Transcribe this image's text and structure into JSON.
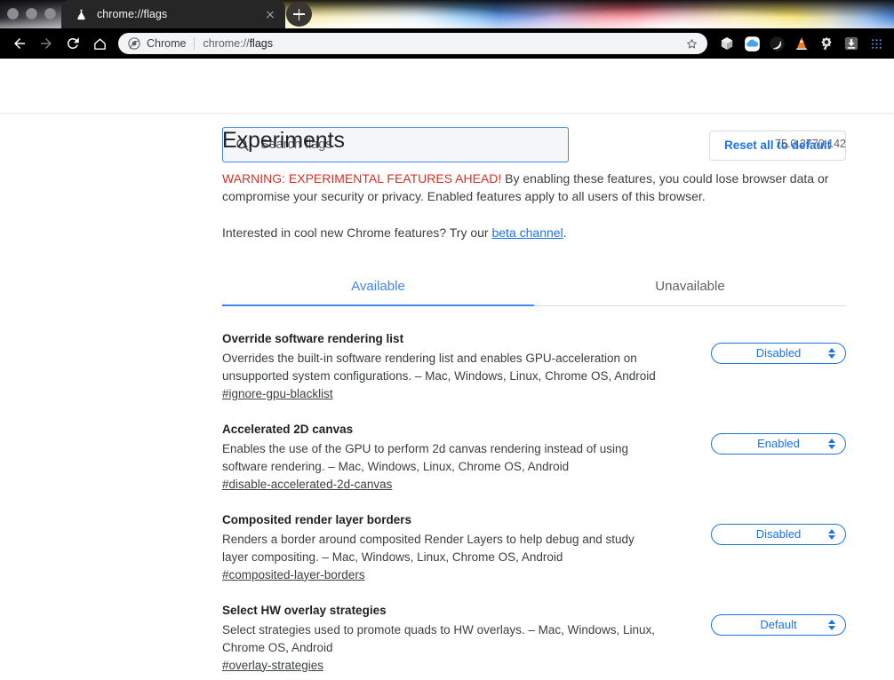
{
  "window": {
    "traffic_lights": [
      "close",
      "minimize",
      "maximize"
    ]
  },
  "tabstrip": {
    "tab": {
      "favicon": "flask-icon",
      "title": "chrome://flags",
      "close_label": "close-tab"
    },
    "new_tab_label": "New Tab"
  },
  "toolbar": {
    "back_label": "Back",
    "forward_label": "Forward",
    "reload_label": "Reload",
    "home_label": "Home",
    "omnibox": {
      "chip_icon": "chrome-logo-icon",
      "chip_text": "Chrome",
      "url_scheme": "chrome://",
      "url_path": "flags",
      "star_label": "Bookmark this page"
    },
    "extensions": [
      {
        "name": "cube-extension-icon",
        "label": "Extension"
      },
      {
        "name": "cloud-extension-icon",
        "label": "Cloud"
      },
      {
        "name": "bittorrent-extension-icon",
        "label": "BitTorrent"
      },
      {
        "name": "vlc-extension-icon",
        "label": "VLC"
      },
      {
        "name": "bug-extension-icon",
        "label": "Debug"
      },
      {
        "name": "download-extension-icon",
        "label": "Downloads"
      },
      {
        "name": "apps-grid-icon",
        "label": "Apps"
      }
    ]
  },
  "flags_page": {
    "search": {
      "icon": "search-icon",
      "placeholder": "Search flags",
      "value": ""
    },
    "reset_button": "Reset all to default",
    "title": "Experiments",
    "version": "75.0.3770.142",
    "warning_strong": "WARNING: EXPERIMENTAL FEATURES AHEAD!",
    "warning_text": " By enabling these features, you could lose browser data or compromise your security or privacy. Enabled features apply to all users of this browser.",
    "beta_prefix": "Interested in cool new Chrome features? Try our ",
    "beta_link": "beta channel",
    "beta_suffix": ".",
    "tabs": [
      {
        "label": "Available",
        "active": true
      },
      {
        "label": "Unavailable",
        "active": false
      }
    ],
    "flags": [
      {
        "name": "Override software rendering list",
        "description": "Overrides the built-in software rendering list and enables GPU-acceleration on unsupported system configurations. – Mac, Windows, Linux, Chrome OS, Android",
        "anchor": "#ignore-gpu-blacklist",
        "value": "Disabled"
      },
      {
        "name": "Accelerated 2D canvas",
        "description": "Enables the use of the GPU to perform 2d canvas rendering instead of using software rendering. – Mac, Windows, Linux, Chrome OS, Android",
        "anchor": "#disable-accelerated-2d-canvas",
        "value": "Enabled"
      },
      {
        "name": "Composited render layer borders",
        "description": "Renders a border around composited Render Layers to help debug and study layer compositing. – Mac, Windows, Linux, Chrome OS, Android",
        "anchor": "#composited-layer-borders",
        "value": "Disabled"
      },
      {
        "name": "Select HW overlay strategies",
        "description": "Select strategies used to promote quads to HW overlays. – Mac, Windows, Linux, Chrome OS, Android",
        "anchor": "#overlay-strategies",
        "value": "Default"
      }
    ]
  },
  "colors": {
    "accent_blue": "#1a73e8",
    "tab_blue": "#4285f4",
    "warning_red": "#d93025",
    "text_primary": "#202124",
    "text_secondary": "#5f6368"
  }
}
